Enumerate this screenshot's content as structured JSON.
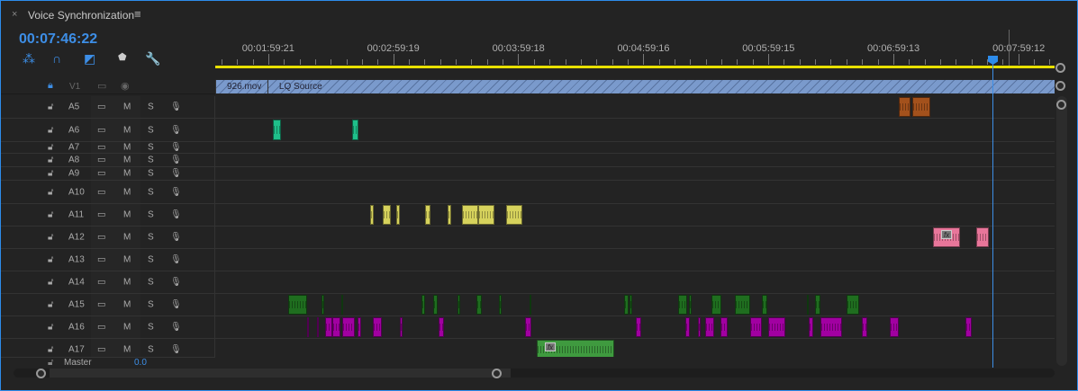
{
  "panel": {
    "close": "×",
    "title": "Voice Synchronization",
    "menu": "≡"
  },
  "timecode": "00:07:46:22",
  "playhead_seconds": 466.9,
  "timeline_view": {
    "start_seconds": 94.5,
    "seconds_visible": 402.2
  },
  "ruler": {
    "labels": [
      {
        "text": "00:01:59:21",
        "sec": 119.9
      },
      {
        "text": "00:02:59:19",
        "sec": 179.8
      },
      {
        "text": "00:03:59:18",
        "sec": 239.8
      },
      {
        "text": "00:04:59:16",
        "sec": 299.7
      },
      {
        "text": "00:05:59:15",
        "sec": 359.6
      },
      {
        "text": "00:06:59:13",
        "sec": 419.5
      },
      {
        "text": "00:07:59:12",
        "sec": 479.5
      }
    ]
  },
  "video": {
    "name": "V1",
    "clips": [
      {
        "label": "926.mov",
        "start": 94.5,
        "end": 119.5
      },
      {
        "label": "LQ Source",
        "start": 119.5,
        "end": 496.7
      }
    ]
  },
  "header_labels": {
    "mute": "M",
    "solo": "S"
  },
  "tracks": [
    {
      "name": "A5",
      "h": 25,
      "color": "#a3511c",
      "clips": [
        [
          422.1,
          427.7
        ],
        [
          428.5,
          437.2
        ]
      ]
    },
    {
      "name": "A6",
      "h": 26,
      "color": "#1fbf8a",
      "clips": [
        [
          122.1,
          126.0
        ],
        [
          160.1,
          163.1
        ]
      ]
    },
    {
      "name": "A7",
      "h": 13,
      "color": "#888",
      "clips": []
    },
    {
      "name": "A8",
      "h": 15,
      "color": "#888",
      "clips": []
    },
    {
      "name": "A9",
      "h": 15,
      "color": "#888",
      "clips": []
    },
    {
      "name": "A10",
      "h": 26,
      "color": "#888",
      "clips": []
    },
    {
      "name": "A11",
      "h": 25,
      "color": "#d6d25c",
      "clips": [
        [
          168.7,
          170.5
        ],
        [
          174.8,
          178.7
        ],
        [
          181.3,
          183.0
        ],
        [
          195.1,
          197.7
        ],
        [
          205.9,
          207.6
        ],
        [
          212.8,
          220.5
        ],
        [
          220.5,
          228.3
        ],
        [
          233.9,
          241.7
        ]
      ]
    },
    {
      "name": "A12",
      "h": 25,
      "color": "#e8769a",
      "clips": [
        [
          438.5,
          451.4
        ],
        [
          459.2,
          465.3
        ]
      ],
      "fx": 0
    },
    {
      "name": "A13",
      "h": 25,
      "color": "#888",
      "clips": []
    },
    {
      "name": "A14",
      "h": 25,
      "color": "#888",
      "clips": []
    },
    {
      "name": "A15",
      "h": 25,
      "color": "#1f6e1f",
      "clips": [
        [
          129.5,
          138.5
        ],
        [
          145.4,
          146.7
        ],
        [
          154.9,
          155.8
        ],
        [
          193.3,
          195.1
        ],
        [
          199.0,
          201.1
        ],
        [
          210.6,
          211.9
        ],
        [
          219.7,
          222.3
        ],
        [
          230.5,
          231.7
        ],
        [
          245.1,
          245.6
        ],
        [
          290.4,
          292.6
        ],
        [
          293.0,
          294.3
        ],
        [
          316.3,
          320.7
        ],
        [
          321.5,
          322.8
        ],
        [
          332.3,
          337.1
        ],
        [
          343.5,
          350.9
        ],
        [
          356.5,
          359.1
        ],
        [
          378.1,
          378.9
        ],
        [
          382.0,
          384.5
        ],
        [
          397.0,
          403.1
        ]
      ]
    },
    {
      "name": "A16",
      "h": 25,
      "color": "#a100a1",
      "clips": [
        [
          138.5,
          139.4
        ],
        [
          143.3,
          144.1
        ],
        [
          147.2,
          150.8
        ],
        [
          150.8,
          154.5
        ],
        [
          155.4,
          161.4
        ],
        [
          162.7,
          164.4
        ],
        [
          170.0,
          174.3
        ],
        [
          183.0,
          184.3
        ],
        [
          201.5,
          204.1
        ],
        [
          243.0,
          246.0
        ],
        [
          296.1,
          298.6
        ],
        [
          319.8,
          322.0
        ],
        [
          325.8,
          327.1
        ],
        [
          329.3,
          333.6
        ],
        [
          336.6,
          340.1
        ],
        [
          350.9,
          356.5
        ],
        [
          359.5,
          367.7
        ],
        [
          378.9,
          381.1
        ],
        [
          384.5,
          394.9
        ],
        [
          404.4,
          407.0
        ],
        [
          417.8,
          422.1
        ],
        [
          454.0,
          457.0
        ]
      ]
    },
    {
      "name": "A17",
      "h": 25,
      "color": "#3f9a3f",
      "clips": [
        [
          248.6,
          285.7
        ]
      ],
      "fx": 0
    }
  ],
  "fx_label": "fx",
  "master": {
    "name": "Master",
    "value": "0.0"
  }
}
